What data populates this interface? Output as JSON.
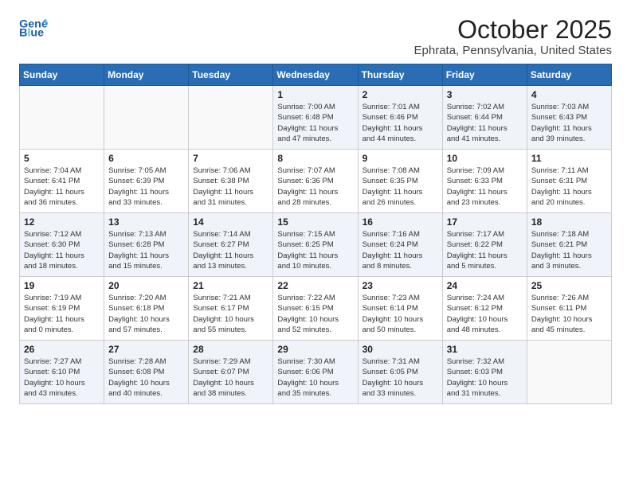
{
  "header": {
    "logo_line1": "General",
    "logo_line2": "Blue",
    "title": "October 2025",
    "subtitle": "Ephrata, Pennsylvania, United States"
  },
  "days_of_week": [
    "Sunday",
    "Monday",
    "Tuesday",
    "Wednesday",
    "Thursday",
    "Friday",
    "Saturday"
  ],
  "weeks": [
    [
      {
        "day": "",
        "info": ""
      },
      {
        "day": "",
        "info": ""
      },
      {
        "day": "",
        "info": ""
      },
      {
        "day": "1",
        "info": "Sunrise: 7:00 AM\nSunset: 6:48 PM\nDaylight: 11 hours\nand 47 minutes."
      },
      {
        "day": "2",
        "info": "Sunrise: 7:01 AM\nSunset: 6:46 PM\nDaylight: 11 hours\nand 44 minutes."
      },
      {
        "day": "3",
        "info": "Sunrise: 7:02 AM\nSunset: 6:44 PM\nDaylight: 11 hours\nand 41 minutes."
      },
      {
        "day": "4",
        "info": "Sunrise: 7:03 AM\nSunset: 6:43 PM\nDaylight: 11 hours\nand 39 minutes."
      }
    ],
    [
      {
        "day": "5",
        "info": "Sunrise: 7:04 AM\nSunset: 6:41 PM\nDaylight: 11 hours\nand 36 minutes."
      },
      {
        "day": "6",
        "info": "Sunrise: 7:05 AM\nSunset: 6:39 PM\nDaylight: 11 hours\nand 33 minutes."
      },
      {
        "day": "7",
        "info": "Sunrise: 7:06 AM\nSunset: 6:38 PM\nDaylight: 11 hours\nand 31 minutes."
      },
      {
        "day": "8",
        "info": "Sunrise: 7:07 AM\nSunset: 6:36 PM\nDaylight: 11 hours\nand 28 minutes."
      },
      {
        "day": "9",
        "info": "Sunrise: 7:08 AM\nSunset: 6:35 PM\nDaylight: 11 hours\nand 26 minutes."
      },
      {
        "day": "10",
        "info": "Sunrise: 7:09 AM\nSunset: 6:33 PM\nDaylight: 11 hours\nand 23 minutes."
      },
      {
        "day": "11",
        "info": "Sunrise: 7:11 AM\nSunset: 6:31 PM\nDaylight: 11 hours\nand 20 minutes."
      }
    ],
    [
      {
        "day": "12",
        "info": "Sunrise: 7:12 AM\nSunset: 6:30 PM\nDaylight: 11 hours\nand 18 minutes."
      },
      {
        "day": "13",
        "info": "Sunrise: 7:13 AM\nSunset: 6:28 PM\nDaylight: 11 hours\nand 15 minutes."
      },
      {
        "day": "14",
        "info": "Sunrise: 7:14 AM\nSunset: 6:27 PM\nDaylight: 11 hours\nand 13 minutes."
      },
      {
        "day": "15",
        "info": "Sunrise: 7:15 AM\nSunset: 6:25 PM\nDaylight: 11 hours\nand 10 minutes."
      },
      {
        "day": "16",
        "info": "Sunrise: 7:16 AM\nSunset: 6:24 PM\nDaylight: 11 hours\nand 8 minutes."
      },
      {
        "day": "17",
        "info": "Sunrise: 7:17 AM\nSunset: 6:22 PM\nDaylight: 11 hours\nand 5 minutes."
      },
      {
        "day": "18",
        "info": "Sunrise: 7:18 AM\nSunset: 6:21 PM\nDaylight: 11 hours\nand 3 minutes."
      }
    ],
    [
      {
        "day": "19",
        "info": "Sunrise: 7:19 AM\nSunset: 6:19 PM\nDaylight: 11 hours\nand 0 minutes."
      },
      {
        "day": "20",
        "info": "Sunrise: 7:20 AM\nSunset: 6:18 PM\nDaylight: 10 hours\nand 57 minutes."
      },
      {
        "day": "21",
        "info": "Sunrise: 7:21 AM\nSunset: 6:17 PM\nDaylight: 10 hours\nand 55 minutes."
      },
      {
        "day": "22",
        "info": "Sunrise: 7:22 AM\nSunset: 6:15 PM\nDaylight: 10 hours\nand 52 minutes."
      },
      {
        "day": "23",
        "info": "Sunrise: 7:23 AM\nSunset: 6:14 PM\nDaylight: 10 hours\nand 50 minutes."
      },
      {
        "day": "24",
        "info": "Sunrise: 7:24 AM\nSunset: 6:12 PM\nDaylight: 10 hours\nand 48 minutes."
      },
      {
        "day": "25",
        "info": "Sunrise: 7:26 AM\nSunset: 6:11 PM\nDaylight: 10 hours\nand 45 minutes."
      }
    ],
    [
      {
        "day": "26",
        "info": "Sunrise: 7:27 AM\nSunset: 6:10 PM\nDaylight: 10 hours\nand 43 minutes."
      },
      {
        "day": "27",
        "info": "Sunrise: 7:28 AM\nSunset: 6:08 PM\nDaylight: 10 hours\nand 40 minutes."
      },
      {
        "day": "28",
        "info": "Sunrise: 7:29 AM\nSunset: 6:07 PM\nDaylight: 10 hours\nand 38 minutes."
      },
      {
        "day": "29",
        "info": "Sunrise: 7:30 AM\nSunset: 6:06 PM\nDaylight: 10 hours\nand 35 minutes."
      },
      {
        "day": "30",
        "info": "Sunrise: 7:31 AM\nSunset: 6:05 PM\nDaylight: 10 hours\nand 33 minutes."
      },
      {
        "day": "31",
        "info": "Sunrise: 7:32 AM\nSunset: 6:03 PM\nDaylight: 10 hours\nand 31 minutes."
      },
      {
        "day": "",
        "info": ""
      }
    ]
  ]
}
